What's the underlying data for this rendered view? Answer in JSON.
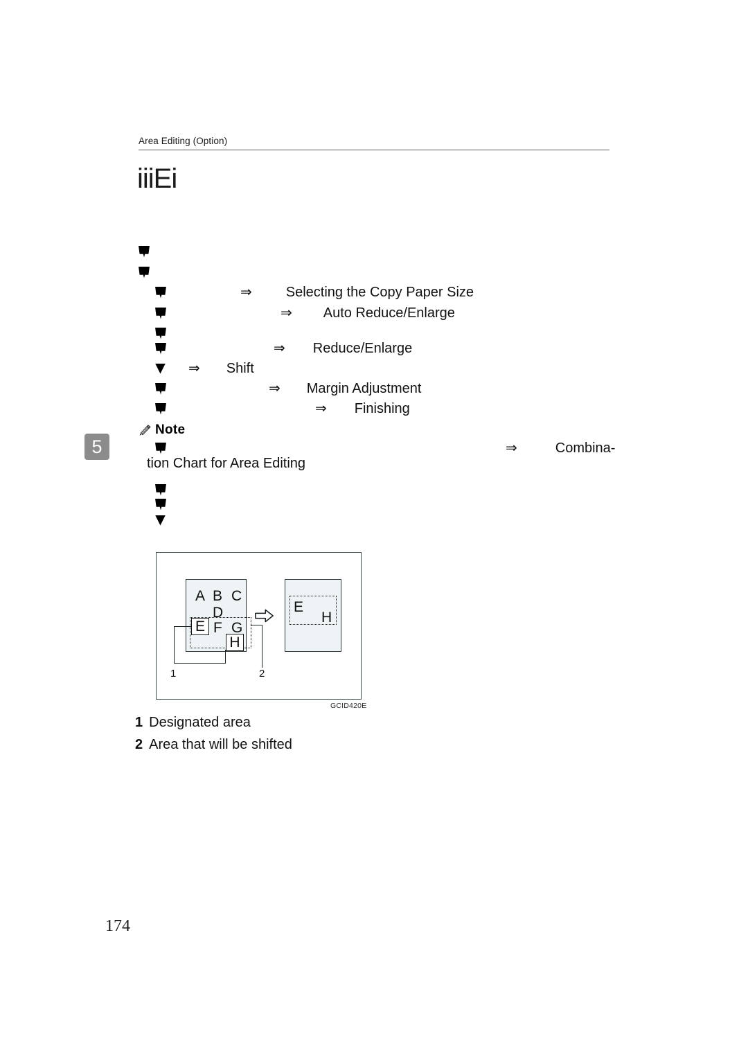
{
  "document": {
    "running_head": "Area Editing (Option)",
    "section_title": "iiiEi",
    "chapter_number": "5",
    "page_number": "174"
  },
  "xref_list": {
    "rows": [
      {
        "marker": "flag-marker",
        "arrow": "",
        "text": ""
      },
      {
        "marker": "flag-marker",
        "arrow": "",
        "text": ""
      },
      {
        "marker": "flag-marker",
        "arrow": "⇒",
        "text": "Selecting the Copy Paper Size"
      },
      {
        "marker": "flag-marker",
        "arrow": "⇒",
        "text": "Auto Reduce/Enlarge"
      },
      {
        "marker": "flag-marker",
        "arrow": "",
        "text": ""
      },
      {
        "marker": "flag-marker",
        "arrow": "⇒",
        "text": "Reduce/Enlarge"
      },
      {
        "marker": "tri-marker",
        "arrow": "⇒",
        "text": "Shift"
      },
      {
        "marker": "flag-marker",
        "arrow": "⇒",
        "text": "Margin Adjustment"
      },
      {
        "marker": "flag-marker",
        "arrow": "⇒",
        "text": "Finishing"
      }
    ]
  },
  "note": {
    "icon": "pencil-icon",
    "label": "Note",
    "first_arrow": "⇒",
    "first_text": "Combina-",
    "continuation": "tion Chart for Area Editing"
  },
  "figure": {
    "id": "GCID420E",
    "arrow": "right-block-arrow",
    "left_page": {
      "letters": [
        "A",
        "B",
        "C",
        "D",
        "F",
        "G"
      ],
      "boxed_letters": [
        "E",
        "H"
      ]
    },
    "right_page": {
      "letters": [
        "E",
        "H"
      ]
    },
    "callouts": [
      "1",
      "2"
    ]
  },
  "legend": {
    "items": [
      {
        "num": "1",
        "text": "Designated area"
      },
      {
        "num": "2",
        "text": "Area that will be shifted"
      }
    ]
  }
}
